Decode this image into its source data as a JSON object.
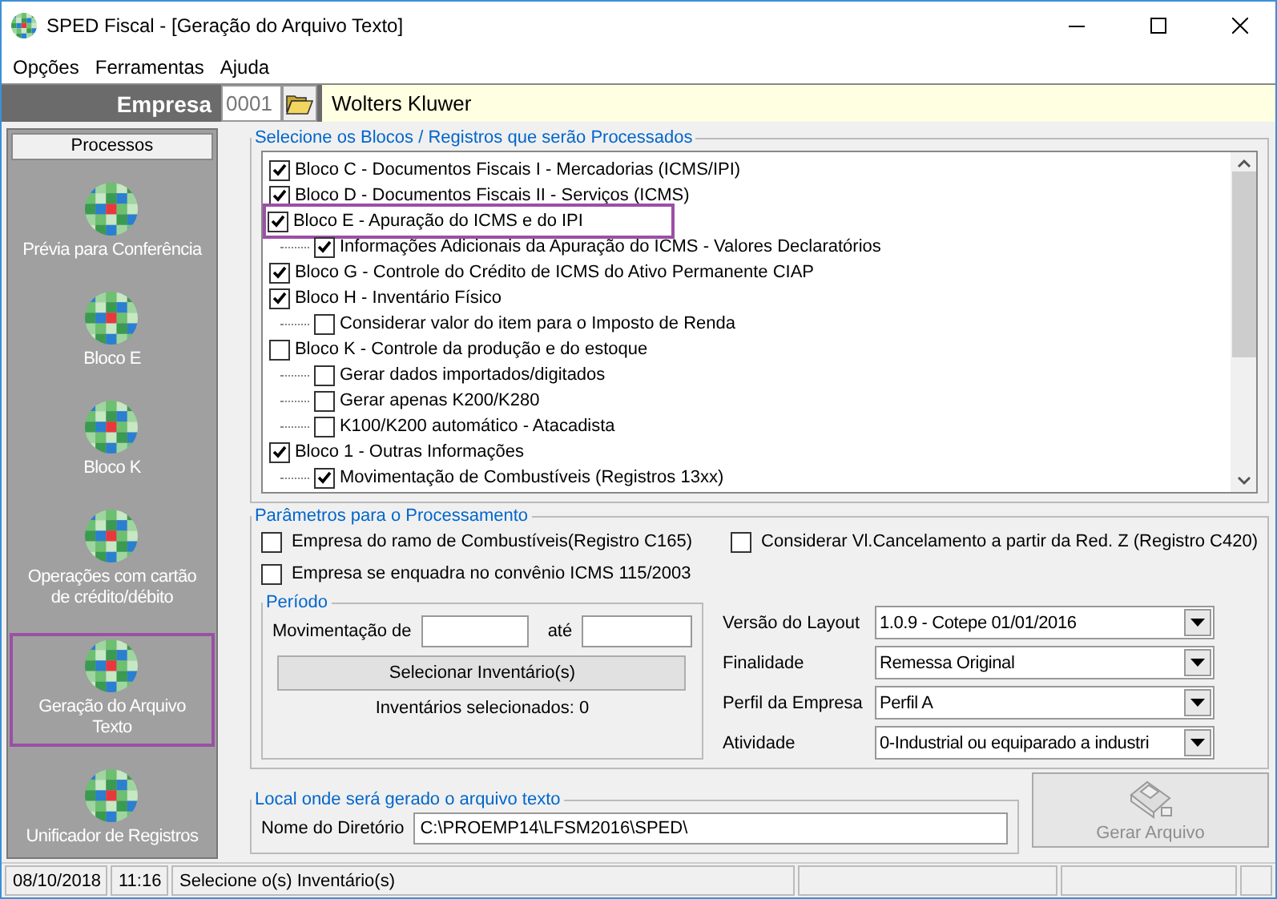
{
  "window": {
    "title": "SPED Fiscal - [Geração do Arquivo Texto]"
  },
  "menu": [
    "Opções",
    "Ferramentas",
    "Ajuda"
  ],
  "company": {
    "label": "Empresa",
    "code": "0001",
    "name": "Wolters Kluwer"
  },
  "sidebar": {
    "title": "Processos",
    "items": [
      {
        "label": "Prévia para Conferência",
        "selected": false
      },
      {
        "label": "Bloco E",
        "selected": false
      },
      {
        "label": "Bloco K",
        "selected": false
      },
      {
        "label": "Operações com cartão de crédito/débito",
        "selected": false
      },
      {
        "label": "Geração do Arquivo Texto",
        "selected": true
      },
      {
        "label": "Unificador de Registros",
        "selected": false
      }
    ]
  },
  "blocks": {
    "title": "Selecione os Blocos / Registros que serão Processados",
    "items": [
      {
        "label": "Bloco C - Documentos Fiscais I - Mercadorias (ICMS/IPI)",
        "checked": true,
        "highlighted": false
      },
      {
        "label": "Bloco D - Documentos Fiscais II - Serviços (ICMS)",
        "checked": true,
        "highlighted": false
      },
      {
        "label": "Bloco E - Apuração do ICMS e do IPI",
        "checked": true,
        "highlighted": true,
        "children": [
          {
            "label": "Informações Adicionais da Apuração do ICMS - Valores Declaratórios",
            "checked": true
          }
        ]
      },
      {
        "label": "Bloco G - Controle do Crédito de ICMS do Ativo Permanente CIAP",
        "checked": true,
        "highlighted": false
      },
      {
        "label": "Bloco H - Inventário Físico",
        "checked": true,
        "highlighted": false,
        "children": [
          {
            "label": "Considerar valor do item para o Imposto de Renda",
            "checked": false
          }
        ]
      },
      {
        "label": "Bloco K - Controle da produção e do estoque",
        "checked": false,
        "highlighted": false,
        "children": [
          {
            "label": "Gerar dados importados/digitados",
            "checked": false
          },
          {
            "label": "Gerar apenas K200/K280",
            "checked": false
          },
          {
            "label": "K100/K200 automático - Atacadista",
            "checked": false
          }
        ]
      },
      {
        "label": "Bloco 1 - Outras Informações",
        "checked": true,
        "highlighted": false,
        "children": [
          {
            "label": "Movimentação de Combustíveis (Registros 13xx)",
            "checked": true
          }
        ]
      }
    ]
  },
  "parameters": {
    "title": "Parâmetros para o Processamento",
    "options": [
      {
        "label": "Empresa do ramo de Combustíveis(Registro C165)",
        "checked": false
      },
      {
        "label": "Considerar Vl.Cancelamento a partir da Red. Z (Registro C420)",
        "checked": false
      },
      {
        "label": "Empresa se enquadra no convênio ICMS 115/2003",
        "checked": false
      }
    ],
    "period": {
      "title": "Período",
      "from_label": "Movimentação de",
      "to_label": "até",
      "button": "Selecionar Inventário(s)",
      "selected_count": "Inventários selecionados: 0"
    },
    "selects": [
      {
        "label": "Versão do Layout",
        "value": "1.0.9 - Cotepe 01/01/2016"
      },
      {
        "label": "Finalidade",
        "value": "Remessa Original"
      },
      {
        "label": "Perfil da Empresa",
        "value": "Perfil A"
      },
      {
        "label": "Atividade",
        "value": "0-Industrial ou equiparado a industri"
      }
    ]
  },
  "output": {
    "title": "Local onde será gerado o arquivo texto",
    "label": "Nome do Diretório",
    "value": "C:\\PROEMP14\\LFSM2016\\SPED\\",
    "button": "Gerar Arquivo",
    "button_disabled": true
  },
  "status_bar": {
    "date": "08/10/2018",
    "time": "11:16",
    "message": "Selecione o(s) Inventário(s)"
  }
}
